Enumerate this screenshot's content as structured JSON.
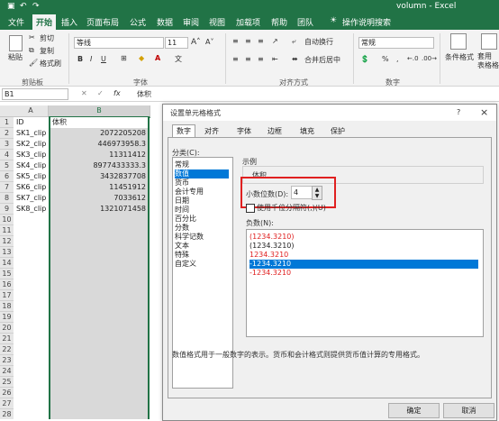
{
  "titlebar": {
    "title": "volumn  -  Excel"
  },
  "tabs": [
    "文件",
    "开始",
    "插入",
    "页面布局",
    "公式",
    "数据",
    "审阅",
    "视图",
    "加载项",
    "帮助",
    "团队"
  ],
  "tellme": "操作说明搜索",
  "ribbon": {
    "paste": "粘贴",
    "cut": "剪切",
    "copy": "复制",
    "format_painter": "格式刷",
    "clipboard_group": "剪贴板",
    "font_name": "等线",
    "font_size": "11",
    "font_group": "字体",
    "wrap_text": "自动换行",
    "merge_center": "合并后居中",
    "align_group": "对齐方式",
    "number_format": "常规",
    "number_group": "数字",
    "cond_format": "条件格式",
    "table_format": "套用\n表格格式"
  },
  "formula_bar": {
    "name_box": "B1",
    "fx": "fx",
    "value": "体积"
  },
  "sheet": {
    "columns": [
      "A",
      "B"
    ],
    "rows": [
      {
        "n": "1",
        "a": "ID",
        "b": "体积"
      },
      {
        "n": "2",
        "a": "SK1_clip",
        "b": "2072205208"
      },
      {
        "n": "3",
        "a": "SK2_clip",
        "b": "446973958.3"
      },
      {
        "n": "4",
        "a": "SK3_clip",
        "b": "11311412"
      },
      {
        "n": "5",
        "a": "SK4_clip",
        "b": "8977433333.3"
      },
      {
        "n": "6",
        "a": "SK5_clip",
        "b": "3432837708"
      },
      {
        "n": "7",
        "a": "SK6_clip",
        "b": "11451912"
      },
      {
        "n": "8",
        "a": "SK7_clip",
        "b": "7033612"
      },
      {
        "n": "9",
        "a": "SK8_clip",
        "b": "1321071458"
      },
      {
        "n": "10"
      },
      {
        "n": "11"
      },
      {
        "n": "12"
      },
      {
        "n": "13"
      },
      {
        "n": "14"
      },
      {
        "n": "15"
      },
      {
        "n": "16"
      },
      {
        "n": "17"
      },
      {
        "n": "18"
      },
      {
        "n": "19"
      },
      {
        "n": "20"
      },
      {
        "n": "21"
      },
      {
        "n": "22"
      },
      {
        "n": "23"
      },
      {
        "n": "24"
      },
      {
        "n": "25"
      },
      {
        "n": "26"
      },
      {
        "n": "27"
      },
      {
        "n": "28"
      }
    ]
  },
  "dialog": {
    "title": "设置单元格格式",
    "help": "?",
    "close": "×",
    "tabs": [
      "数字",
      "对齐",
      "字体",
      "边框",
      "填充",
      "保护"
    ],
    "category_label": "分类(C):",
    "categories": [
      "常规",
      "数值",
      "货币",
      "会计专用",
      "日期",
      "时间",
      "百分比",
      "分数",
      "科学记数",
      "文本",
      "特殊",
      "自定义"
    ],
    "selected_category": "数值",
    "sample_label": "示例",
    "sample_value": "体积",
    "decimal_label": "小数位数(D):",
    "decimal_value": "4",
    "thousands_label": "使用千位分隔符(,)(U)",
    "negative_label": "负数(N):",
    "negatives": [
      {
        "text": "(1234.3210)",
        "color": "#e02020"
      },
      {
        "text": "(1234.3210)",
        "color": "#222222"
      },
      {
        "text": "1234.3210",
        "color": "#e02020"
      },
      {
        "text": "-1234.3210",
        "color": "#ffffff",
        "selected": true
      },
      {
        "text": "-1234.3210",
        "color": "#e02020"
      }
    ],
    "description": "数值格式用于一般数字的表示。货币和会计格式则提供货币值计算的专用格式。",
    "ok": "确定",
    "cancel": "取消"
  },
  "colors": {
    "excel_green": "#217346",
    "selection_blue": "#0078d7",
    "highlight_red": "#e02020"
  }
}
